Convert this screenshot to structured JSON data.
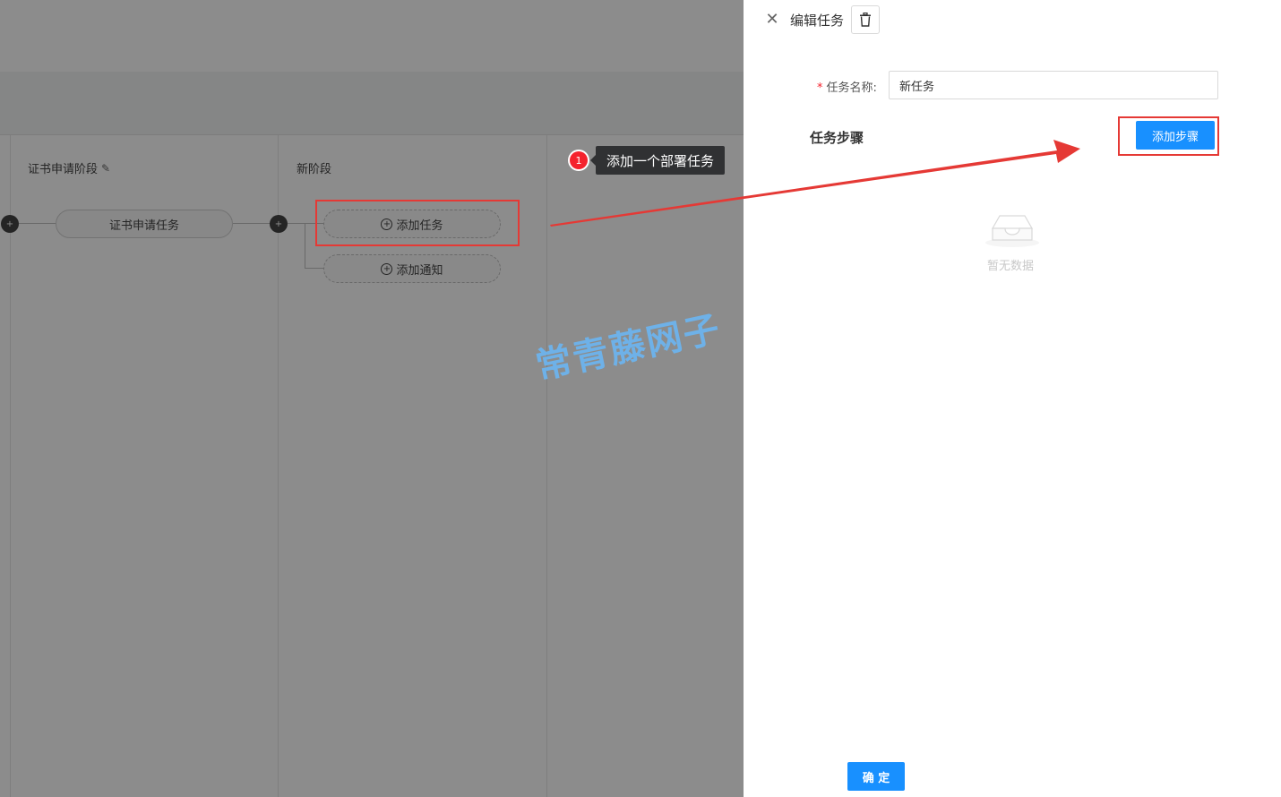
{
  "canvas": {
    "stages": [
      {
        "title": "证书申请阶段",
        "tasks": [
          "证书申请任务"
        ]
      },
      {
        "title": "新阶段",
        "actions": {
          "add_task": "添加任务",
          "add_notice": "添加通知"
        }
      }
    ]
  },
  "annotation": {
    "badge_number": "1",
    "tooltip": "添加一个部署任务",
    "watermark": "常青藤网子",
    "highlight_color": "#e53935"
  },
  "drawer": {
    "title": "编辑任务",
    "form": {
      "name_label": "任务名称:",
      "name_value": "新任务"
    },
    "steps_section": {
      "title": "任务步骤",
      "add_step_label": "添加步骤",
      "empty_text": "暂无数据"
    },
    "confirm_label": "确 定"
  },
  "colors": {
    "primary": "#1890ff",
    "mask": "rgba(0,0,0,0.45)",
    "required": "#f5222d"
  },
  "icons": {
    "close": "close-icon",
    "delete": "trash-icon",
    "edit": "pencil-icon",
    "add": "plus-circle-icon",
    "empty": "empty-inbox-icon"
  }
}
